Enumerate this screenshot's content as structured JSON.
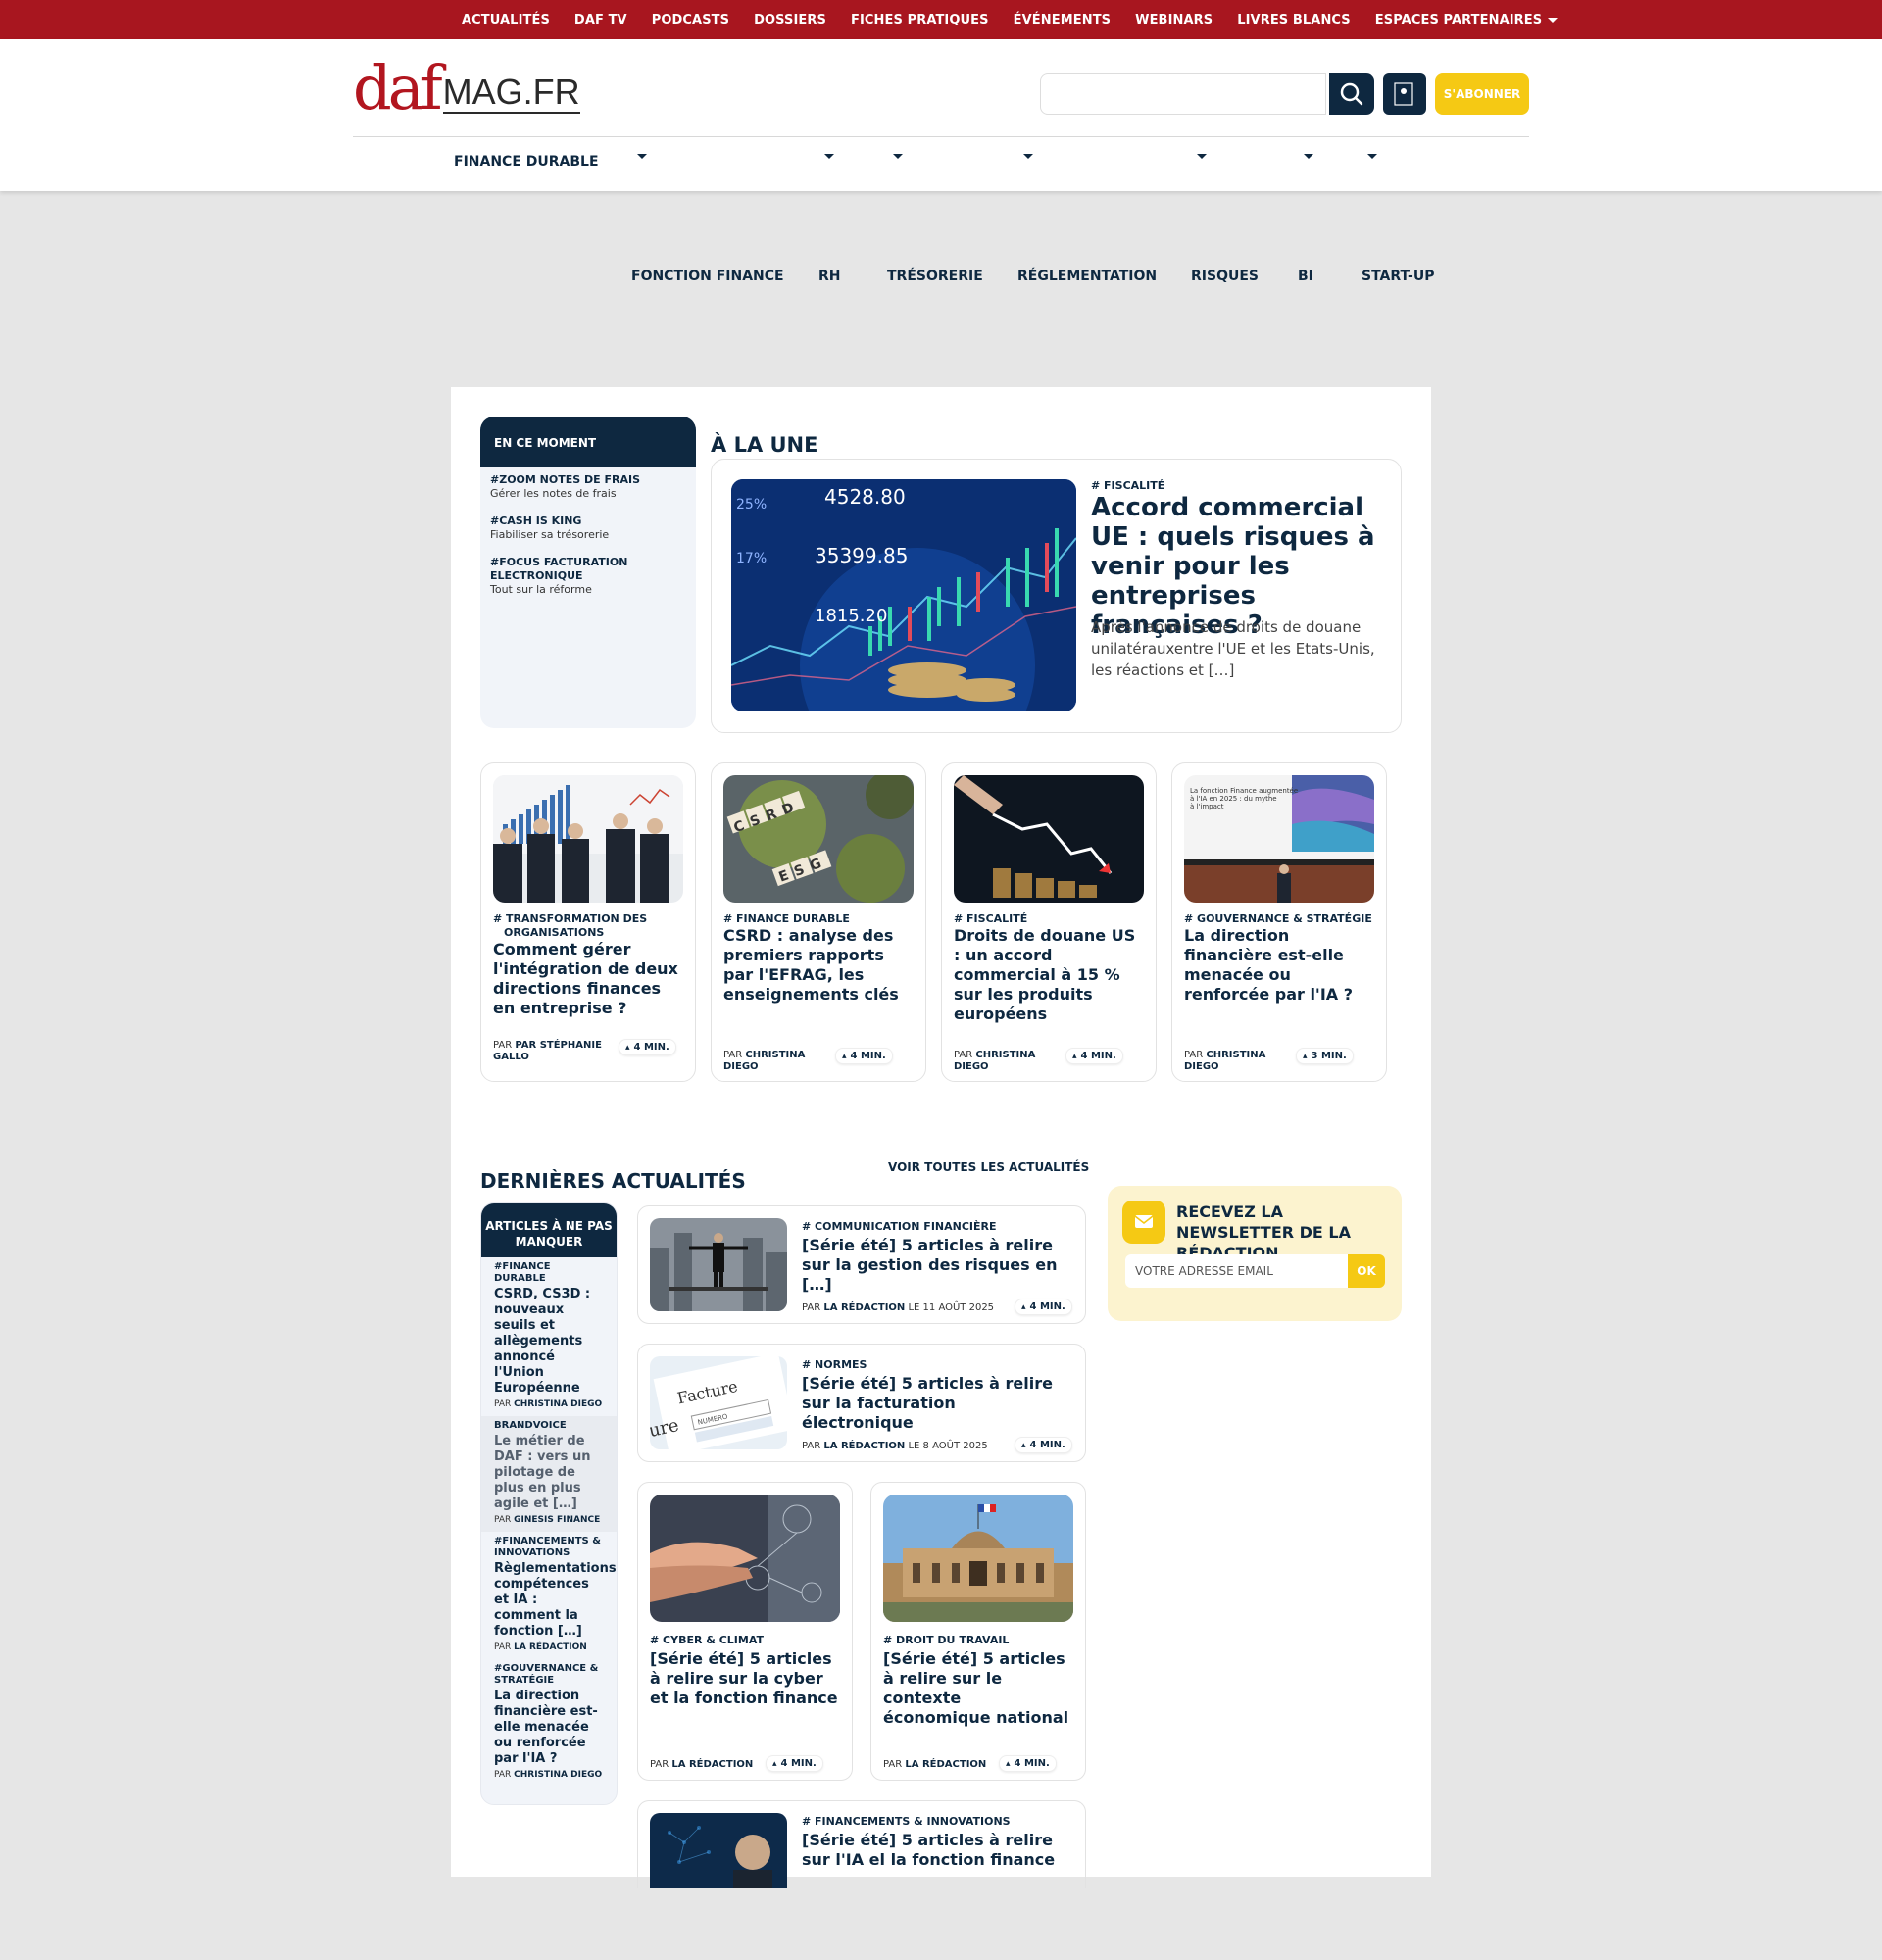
{
  "top_nav": [
    "ACTUALITÉS",
    "DAF TV",
    "PODCASTS",
    "DOSSIERS",
    "FICHES PRATIQUES",
    "ÉVÉNEMENTS",
    "WEBINARS",
    "LIVRES BLANCS",
    "ESPACES PARTENAIRES"
  ],
  "logo": {
    "daf": "daf",
    "mag": "MAG.FR"
  },
  "header": {
    "subscribe": "S'ABONNER"
  },
  "main_nav": [
    "FINANCE DURABLE",
    "FONCTION FINANCE",
    "RH",
    "TRÉSORERIE",
    "RÉGLEMENTATION",
    "RISQUES",
    "BI",
    "START-UP"
  ],
  "en_ce_moment": {
    "title": "EN CE MOMENT",
    "items": [
      {
        "tag": "#ZOOM NOTES DE FRAIS",
        "sub": "Gérer les notes de frais"
      },
      {
        "tag": "#CASH IS KING",
        "sub": "Fiabiliser sa trésorerie"
      },
      {
        "tag": "#FOCUS FACTURATION ELECTRONIQUE",
        "sub": "Tout sur la réforme"
      }
    ]
  },
  "a_la_une": {
    "title": "À LA UNE",
    "hero": {
      "tag": "# FISCALITÉ",
      "title": "Accord commercial UE : quels risques à venir pour les entreprises françaises ?",
      "desc": "Après l'annonce de droits de douane unilatérauxentre l'UE et les Etats-Unis, les réactions et […]",
      "img_numbers": [
        "4528.80",
        "35399.85",
        "1815.20",
        "25%",
        "17%"
      ]
    },
    "cards": [
      {
        "tag": "# TRANSFORMATION DES ORGANISATIONS",
        "title": "Comment gérer l'intégration de deux directions finances en entreprise ?",
        "by_prefix": "PAR",
        "author": "PAR STÉPHANIE GALLO",
        "time": "4 MIN."
      },
      {
        "tag": "# FINANCE DURABLE",
        "title": "CSRD : analyse des premiers rapports par l'EFRAG, les enseignements clés",
        "by_prefix": "PAR",
        "author": "CHRISTINA DIEGO",
        "time": "4 MIN."
      },
      {
        "tag": "# FISCALITÉ",
        "title": "Droits de douane US : un accord commercial à 15 % sur les produits européens",
        "by_prefix": "PAR",
        "author": "CHRISTINA DIEGO",
        "time": "4 MIN."
      },
      {
        "tag": "# GOUVERNANCE & STRATÉGIE",
        "title": "La direction financière est-elle menacée ou renforcée par l'IA ?",
        "by_prefix": "PAR",
        "author": "CHRISTINA DIEGO",
        "time": "3 MIN."
      }
    ],
    "card_img_text": {
      "csrd": "CSRD",
      "esg": "ESG",
      "slide": "La fonction Finance augmentée à l'IA en 2025 : du mythe à l'impact"
    }
  },
  "dernieres": {
    "title": "DERNIÈRES ACTUALITÉS",
    "voir": "VOIR TOUTES LES ACTUALITÉS",
    "apm": {
      "title": "ARTICLES À NE PAS MANQUER",
      "items": [
        {
          "tag": "#FINANCE DURABLE",
          "title": "CSRD, CS3D : nouveaux seuils et allègements annoncé l'Union Européenne",
          "by_prefix": "PAR",
          "author": "CHRISTINA DIEGO"
        },
        {
          "tag": "BRANDVOICE",
          "title": "Le métier de DAF : vers un pilotage de plus en plus agile et […]",
          "by_prefix": "PAR",
          "author": "GINESIS FINANCE"
        },
        {
          "tag": "#FINANCEMENTS & INNOVATIONS",
          "title": "Règlementations, compétences et IA : comment la fonction […]",
          "by_prefix": "PAR",
          "author": "LA RÉDACTION"
        },
        {
          "tag": "#GOUVERNANCE & STRATÉGIE",
          "title": "La direction financière est-elle menacée ou renforcée par l'IA ?",
          "by_prefix": "PAR",
          "author": "CHRISTINA DIEGO"
        }
      ]
    },
    "rows": [
      {
        "tag": "# COMMUNICATION FINANCIÈRE",
        "title": "[Série été] 5 articles à relire sur la gestion des risques en […]",
        "by_prefix": "PAR",
        "author": "LA RÉDACTION",
        "date": "LE 11 AOÛT 2025",
        "time": "4 MIN."
      },
      {
        "tag": "# NORMES",
        "title": "[Série été] 5 articles à relire sur la facturation électronique",
        "by_prefix": "PAR",
        "author": "LA RÉDACTION",
        "date": "LE 8 AOÛT 2025",
        "time": "4 MIN."
      }
    ],
    "row_img_text": {
      "facture": "Facture",
      "numero": "NUMERO"
    },
    "squares": [
      {
        "tag": "# CYBER & CLIMAT",
        "title": "[Série été] 5 articles à relire sur la cyber et la fonction finance",
        "by_prefix": "PAR",
        "author": "LA RÉDACTION",
        "time": "4 MIN."
      },
      {
        "tag": "# DROIT DU TRAVAIL",
        "title": "[Série été] 5 articles à relire sur le contexte économique national",
        "by_prefix": "PAR",
        "author": "LA RÉDACTION",
        "time": "4 MIN."
      }
    ],
    "last_row": {
      "tag": "# FINANCEMENTS & INNOVATIONS",
      "title": "[Série été] 5 articles à relire sur l'IA el la fonction finance"
    }
  },
  "newsletter": {
    "title": "RECEVEZ LA NEWSLETTER DE LA RÉDACTION",
    "placeholder": "VOTRE ADRESSE EMAIL",
    "ok": "OK"
  },
  "icons": [
    "search-icon",
    "user-icon",
    "envelope-icon",
    "clock-icon"
  ],
  "colors": {
    "brand_red": "#a8161f",
    "navy": "#0e2840",
    "yellow": "#f5c914",
    "newsletter_bg": "#fcf3cf"
  }
}
